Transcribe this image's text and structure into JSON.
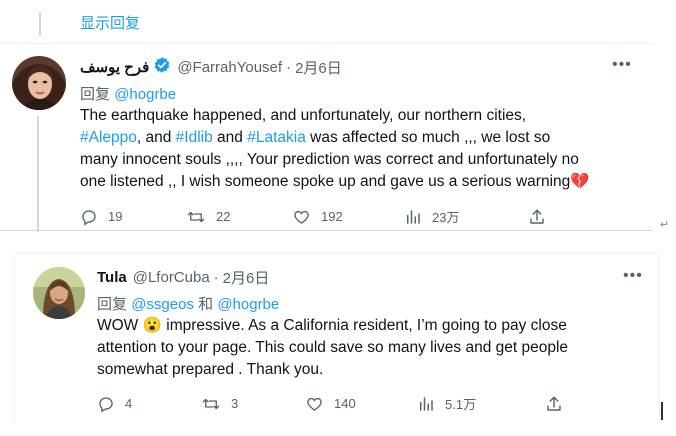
{
  "show_replies": "显示回复",
  "tweets": [
    {
      "display_name": "فرح يوسف",
      "handle": "@FarrahYousef",
      "separator": "·",
      "date": "2月6日",
      "reply_prefix": "回复",
      "reply_mentions": "@hogrbe",
      "body": {
        "l1": "The earthquake happened, and unfortunately, our northern cities,",
        "tag1": "#Aleppo",
        "l2a": ", and ",
        "tag2": "#Idlib",
        "l2b": " and ",
        "tag3": "#Latakia",
        "l2c": " was affected so much ,,, we lost so",
        "l3": "many innocent souls ,,,, Your prediction was correct and unfortunately no",
        "l4": "one listened ,, I wish someone spoke up and gave us a serious warning",
        "emoji": "💔"
      },
      "actions": {
        "replies": "19",
        "retweets": "22",
        "likes": "192",
        "views": "23万"
      }
    },
    {
      "display_name": "Tula",
      "handle": "@LforCuba",
      "separator": "·",
      "date": "2月6日",
      "reply_prefix": "回复",
      "mention1": "@ssgeos",
      "and_word": "和",
      "mention2": "@hogrbe",
      "body": {
        "l1a": "WOW ",
        "emoji": "😮",
        "l1b": " impressive. As a California resident, I’m going to pay close",
        "l2": "attention to your page. This could save so many lives and get people",
        "l3": "somewhat prepared . Thank you."
      },
      "actions": {
        "replies": "4",
        "retweets": "3",
        "likes": "140",
        "views": "5.1万"
      }
    }
  ],
  "colors": {
    "link": "#1d9bf0",
    "muted": "#536471",
    "text": "#0f1419",
    "verified": "#1d9bf0"
  },
  "icons": [
    "more-icon",
    "verified-badge-icon",
    "reply-icon",
    "retweet-icon",
    "like-icon",
    "views-icon",
    "share-icon"
  ],
  "marks": {
    "enter": "↵"
  }
}
